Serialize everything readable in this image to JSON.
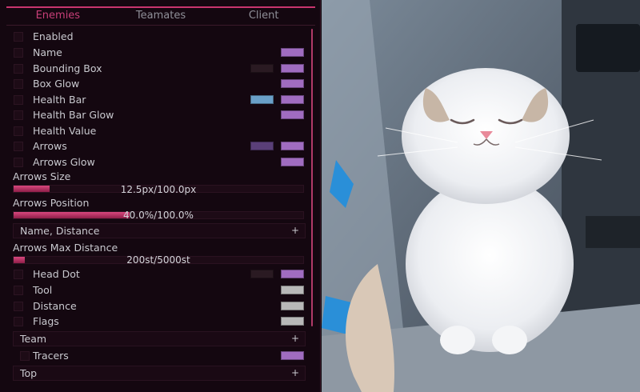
{
  "tabs": [
    {
      "label": "Enemies",
      "active": true
    },
    {
      "label": "Teamates",
      "active": false
    },
    {
      "label": "Client",
      "active": false
    }
  ],
  "options": {
    "enabled": {
      "label": "Enabled"
    },
    "name": {
      "label": "Name",
      "colors": [
        "#a06cc0"
      ]
    },
    "bounding_box": {
      "label": "Bounding Box",
      "colors": [
        "#2a1a22",
        "#a06cc0"
      ]
    },
    "box_glow": {
      "label": "Box Glow",
      "colors": [
        "#a06cc0"
      ]
    },
    "health_bar": {
      "label": "Health Bar",
      "colors": [
        "#6aa0c8",
        "#a06cc0"
      ]
    },
    "health_bar_glow": {
      "label": "Health Bar Glow",
      "colors": [
        "#a06cc0"
      ]
    },
    "health_value": {
      "label": "Health Value"
    },
    "arrows": {
      "label": "Arrows",
      "colors": [
        "#5a3f78",
        "#a06cc0"
      ]
    },
    "arrows_glow": {
      "label": "Arrows Glow",
      "colors": [
        "#a06cc0"
      ]
    }
  },
  "sliders": {
    "arrows_size": {
      "label": "Arrows Size",
      "value_text": "12.5px/100.0px",
      "fraction": 0.125
    },
    "arrows_position": {
      "label": "Arrows Position",
      "value_text": "40.0%/100.0%",
      "fraction": 0.4
    },
    "arrows_max_distance": {
      "label": "Arrows Max Distance",
      "value_text": "200st/5000st",
      "fraction": 0.04
    }
  },
  "combos": {
    "name_distance": {
      "label": "Name, Distance",
      "icon": "+"
    },
    "team": {
      "label": "Team",
      "icon": "+"
    },
    "top": {
      "label": "Top",
      "icon": "+"
    }
  },
  "options2": {
    "head_dot": {
      "label": "Head Dot",
      "colors": [
        "#2a1a22",
        "#a06cc0"
      ]
    },
    "tool": {
      "label": "Tool",
      "colors": [
        "#b8b8b8"
      ]
    },
    "distance": {
      "label": "Distance",
      "colors": [
        "#b8b8b8"
      ]
    },
    "flags": {
      "label": "Flags",
      "colors": [
        "#b8b8b8"
      ]
    },
    "tracers": {
      "label": "Tracers",
      "colors": [
        "#a06cc0"
      ]
    }
  },
  "background_photo": {
    "subject": "white fluffy cat"
  }
}
